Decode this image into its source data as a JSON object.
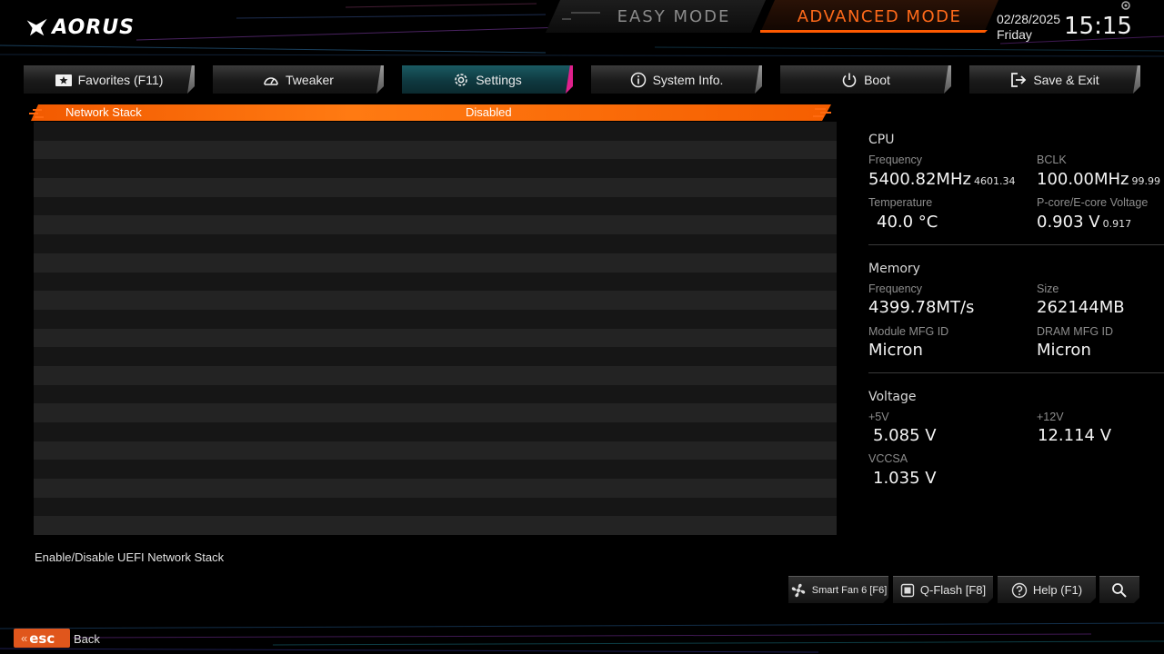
{
  "brand": {
    "logo_text": "AORUS"
  },
  "modes": {
    "easy": "EASY MODE",
    "advanced": "ADVANCED MODE",
    "accent": "#ff5a00"
  },
  "clock": {
    "date": "02/28/2025",
    "day": "Friday",
    "time": "15:15"
  },
  "tabs": [
    {
      "label": "Favorites (F11)",
      "icon": "star-folder-icon",
      "active": false
    },
    {
      "label": "Tweaker",
      "icon": "speedometer-icon",
      "active": false
    },
    {
      "label": "Settings",
      "icon": "gear-icon",
      "active": true
    },
    {
      "label": "System Info.",
      "icon": "info-icon",
      "active": false
    },
    {
      "label": "Boot",
      "icon": "power-icon",
      "active": false
    },
    {
      "label": "Save & Exit",
      "icon": "exit-icon",
      "active": false
    }
  ],
  "settings": {
    "selected": {
      "label": "Network Stack",
      "value": "Disabled"
    },
    "empty_rows": 22,
    "help": "Enable/Disable UEFI Network Stack"
  },
  "status": {
    "cpu": {
      "title": "CPU",
      "frequency_label": "Frequency",
      "frequency": "5400.82MHz",
      "frequency_sub": "4601.34",
      "bclk_label": "BCLK",
      "bclk": "100.00MHz",
      "bclk_sub": "99.99",
      "temperature_label": "Temperature",
      "temperature": "40.0 °C",
      "voltage_label": "P-core/E-core Voltage",
      "voltage": "0.903 V",
      "voltage_sub": "0.917"
    },
    "memory": {
      "title": "Memory",
      "frequency_label": "Frequency",
      "frequency": "4399.78MT/s",
      "size_label": "Size",
      "size": "262144MB",
      "module_label": "Module MFG ID",
      "module": "Micron",
      "dram_label": "DRAM MFG ID",
      "dram": "Micron"
    },
    "voltage": {
      "title": "Voltage",
      "v5_label": "+5V",
      "v5": "5.085 V",
      "v12_label": "+12V",
      "v12": "12.114 V",
      "vccsa_label": "VCCSA",
      "vccsa": "1.035 V"
    }
  },
  "bottom": {
    "smartfan": "Smart Fan 6 [F6]",
    "qflash": "Q-Flash [F8]",
    "help": "Help (F1)",
    "search_icon": "search-icon"
  },
  "footer": {
    "esc_key": "esc",
    "back": "Back"
  }
}
